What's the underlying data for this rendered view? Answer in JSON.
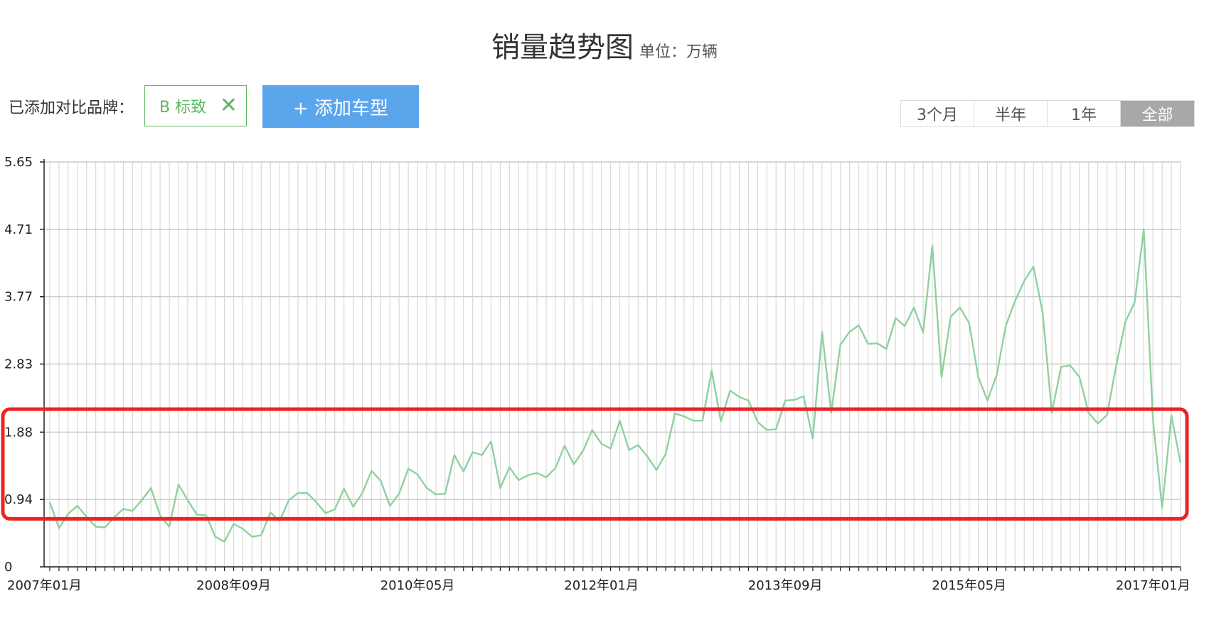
{
  "header": {
    "title": "销量趋势图",
    "unit": "单位：万辆"
  },
  "compare": {
    "label": "已添加对比品牌：",
    "brand_chip": "B 标致",
    "add_button": "+ 添加车型"
  },
  "range_buttons": [
    {
      "label": "3个月",
      "active": false
    },
    {
      "label": "半年",
      "active": false
    },
    {
      "label": "1年",
      "active": false
    },
    {
      "label": "全部",
      "active": true
    }
  ],
  "colors": {
    "line": "#8fd19e",
    "highlight": "#ee2222",
    "brand": "#5cb85c",
    "button": "#5ba5ec"
  },
  "chart_data": {
    "type": "line",
    "title": "销量趋势图",
    "ylabel": "单位：万辆",
    "ylim": [
      0,
      5.65
    ],
    "ytick_labels": [
      "0",
      "0.94",
      "1.88",
      "2.83",
      "3.77",
      "4.71",
      "5.65"
    ],
    "xtick_labels": [
      {
        "index": 0,
        "label": "2007年01月"
      },
      {
        "index": 20,
        "label": "2008年09月"
      },
      {
        "index": 40,
        "label": "2010年05月"
      },
      {
        "index": 60,
        "label": "2012年01月"
      },
      {
        "index": 80,
        "label": "2013年09月"
      },
      {
        "index": 100,
        "label": "2015年05月"
      },
      {
        "index": 120,
        "label": "2017年01月"
      }
    ],
    "grid": true,
    "highlight_range": {
      "y_min": 0.67,
      "y_max": 2.2
    },
    "series": [
      {
        "values": [
          0.9,
          0.54,
          0.74,
          0.85,
          0.7,
          0.56,
          0.55,
          0.69,
          0.81,
          0.78,
          0.93,
          1.1,
          0.72,
          0.56,
          1.15,
          0.93,
          0.73,
          0.72,
          0.42,
          0.35,
          0.6,
          0.53,
          0.42,
          0.44,
          0.76,
          0.64,
          0.93,
          1.03,
          1.03,
          0.9,
          0.75,
          0.8,
          1.09,
          0.84,
          1.03,
          1.34,
          1.2,
          0.85,
          1.02,
          1.37,
          1.29,
          1.1,
          1.01,
          1.02,
          1.56,
          1.33,
          1.6,
          1.56,
          1.75,
          1.1,
          1.39,
          1.21,
          1.28,
          1.31,
          1.25,
          1.38,
          1.69,
          1.43,
          1.62,
          1.91,
          1.72,
          1.65,
          2.04,
          1.63,
          1.7,
          1.54,
          1.35,
          1.58,
          2.14,
          2.1,
          2.04,
          2.04,
          2.74,
          2.03,
          2.46,
          2.37,
          2.32,
          2.02,
          1.91,
          1.92,
          2.32,
          2.33,
          2.38,
          1.79,
          3.28,
          2.15,
          3.1,
          3.28,
          3.37,
          3.11,
          3.12,
          3.04,
          3.47,
          3.36,
          3.62,
          3.27,
          4.48,
          2.65,
          3.49,
          3.62,
          3.4,
          2.65,
          2.32,
          2.68,
          3.37,
          3.71,
          3.99,
          4.19,
          3.55,
          2.15,
          2.79,
          2.81,
          2.65,
          2.15,
          2.0,
          2.12,
          2.81,
          3.42,
          3.69,
          4.71,
          2.05,
          0.82,
          2.11,
          1.45
        ]
      }
    ]
  }
}
